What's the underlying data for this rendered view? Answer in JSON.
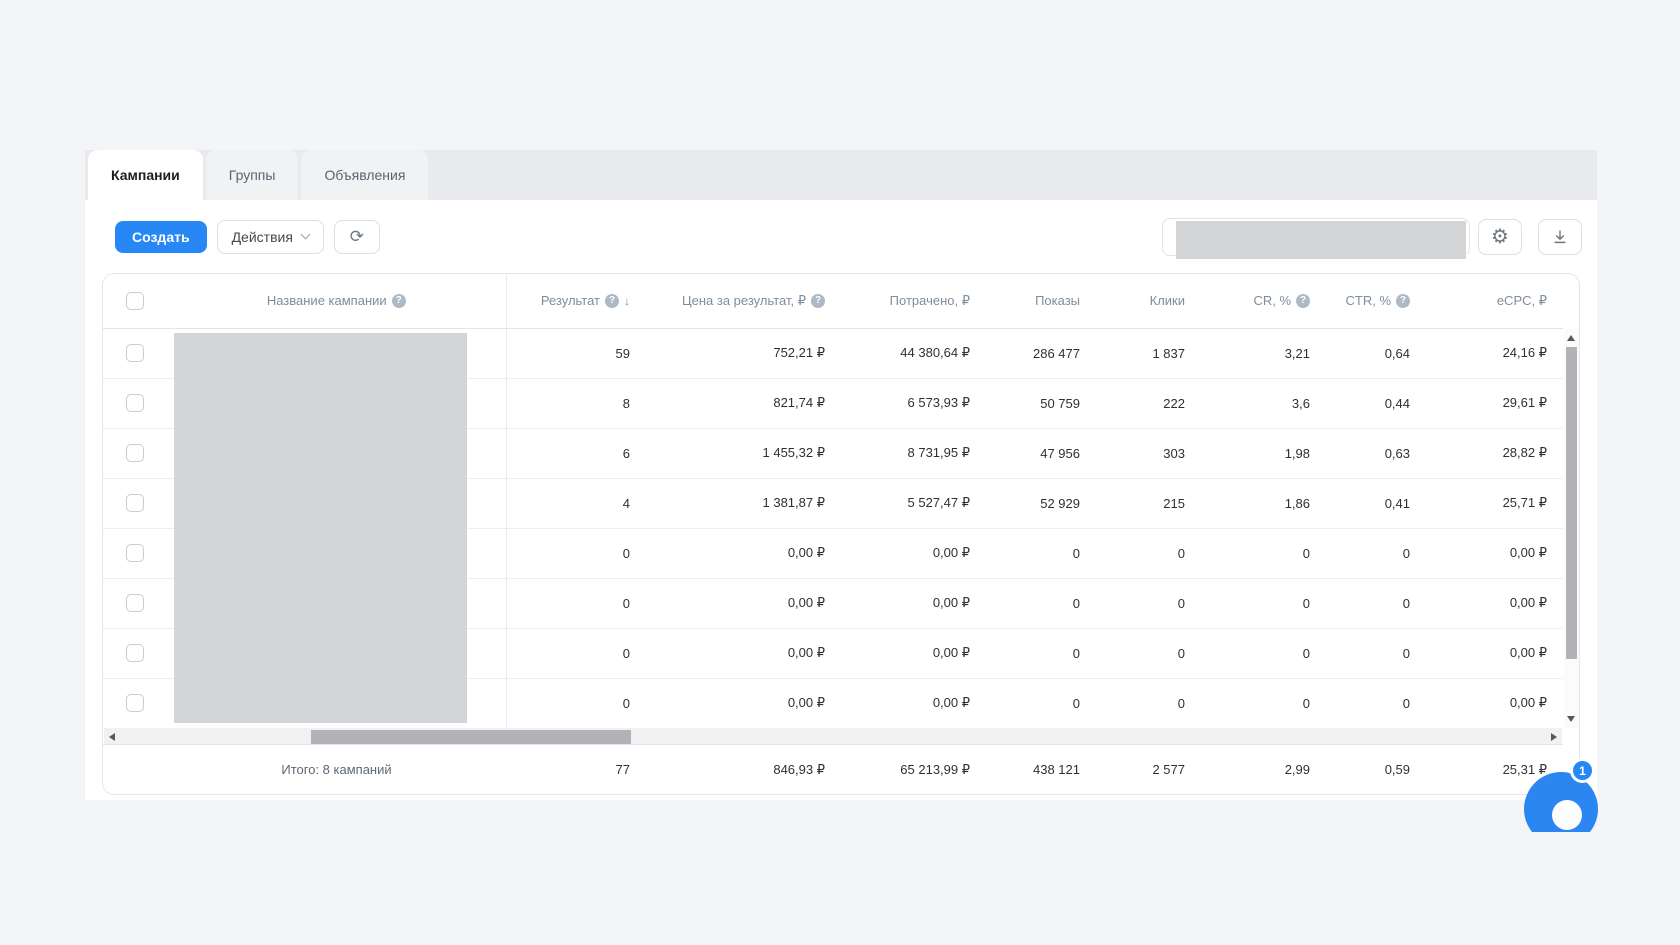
{
  "tabs": {
    "campaigns": "Кампании",
    "groups": "Группы",
    "ads": "Объявления"
  },
  "toolbar": {
    "create": "Создать",
    "actions": "Действия"
  },
  "icons": {
    "help": "?",
    "sort_desc": "↓",
    "refresh": "⟳",
    "gear": "⚙"
  },
  "table": {
    "headers": {
      "name": "Название кампании",
      "result": "Результат",
      "cost_per_result": "Цена за результат, ₽",
      "spent": "Потрачено, ₽",
      "impressions": "Показы",
      "clicks": "Клики",
      "cr": "CR, %",
      "ctr": "CTR, %",
      "ecpc": "eCPC, ₽"
    },
    "rows": [
      {
        "result": "59",
        "cost_per_result": "752,21 ₽",
        "spent": "44 380,64 ₽",
        "impressions": "286 477",
        "clicks": "1 837",
        "cr": "3,21",
        "ctr": "0,64",
        "ecpc": "24,16 ₽"
      },
      {
        "result": "8",
        "cost_per_result": "821,74 ₽",
        "spent": "6 573,93 ₽",
        "impressions": "50 759",
        "clicks": "222",
        "cr": "3,6",
        "ctr": "0,44",
        "ecpc": "29,61 ₽"
      },
      {
        "result": "6",
        "cost_per_result": "1 455,32 ₽",
        "spent": "8 731,95 ₽",
        "impressions": "47 956",
        "clicks": "303",
        "cr": "1,98",
        "ctr": "0,63",
        "ecpc": "28,82 ₽"
      },
      {
        "result": "4",
        "cost_per_result": "1 381,87 ₽",
        "spent": "5 527,47 ₽",
        "impressions": "52 929",
        "clicks": "215",
        "cr": "1,86",
        "ctr": "0,41",
        "ecpc": "25,71 ₽"
      },
      {
        "result": "0",
        "cost_per_result": "0,00 ₽",
        "spent": "0,00 ₽",
        "impressions": "0",
        "clicks": "0",
        "cr": "0",
        "ctr": "0",
        "ecpc": "0,00 ₽"
      },
      {
        "result": "0",
        "cost_per_result": "0,00 ₽",
        "spent": "0,00 ₽",
        "impressions": "0",
        "clicks": "0",
        "cr": "0",
        "ctr": "0",
        "ecpc": "0,00 ₽"
      },
      {
        "result": "0",
        "cost_per_result": "0,00 ₽",
        "spent": "0,00 ₽",
        "impressions": "0",
        "clicks": "0",
        "cr": "0",
        "ctr": "0",
        "ecpc": "0,00 ₽"
      },
      {
        "result": "0",
        "cost_per_result": "0,00 ₽",
        "spent": "0,00 ₽",
        "impressions": "0",
        "clicks": "0",
        "cr": "0",
        "ctr": "0",
        "ecpc": "0,00 ₽"
      }
    ],
    "footer": {
      "label": "Итого: 8 кампаний",
      "result": "77",
      "cost_per_result": "846,93 ₽",
      "spent": "65 213,99 ₽",
      "impressions": "438 121",
      "clicks": "2 577",
      "cr": "2,99",
      "ctr": "0,59",
      "ecpc": "25,31 ₽"
    }
  },
  "chat": {
    "badge": "1"
  },
  "colors": {
    "accent": "#2787f5",
    "redaction": "#d4d5d7"
  }
}
